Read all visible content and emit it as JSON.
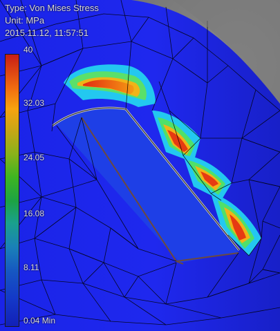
{
  "overlay": {
    "type_line": "Type: Von Mises Stress",
    "unit_line": "Unit: MPa",
    "datetime_line": "2015.11.12, 11:57:51"
  },
  "legend": {
    "max_label": "40",
    "ticks": [
      "32.03",
      "24.05",
      "16.08",
      "8.11",
      "0.04 Min"
    ],
    "colors": {
      "max": "#c81d16",
      "high": "#f06a10",
      "mid_high": "#f7a40f",
      "mid": "#3fb521",
      "mid_low": "#1a80b8",
      "min": "#1220b8"
    }
  },
  "scene": {
    "background_color": "#6f6f6f",
    "part_color": "#1a24e8",
    "mesh_line_color": "#000000"
  }
}
